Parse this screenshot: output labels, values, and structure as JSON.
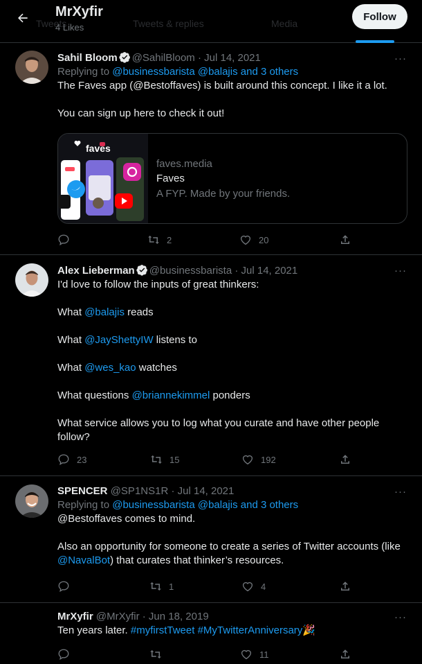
{
  "header": {
    "title": "MrXyfir",
    "subtitle": "4 Likes",
    "follow_label": "Follow",
    "ghost_tabs": [
      "Tweets",
      "Tweets & replies",
      "Media"
    ]
  },
  "tweets": [
    {
      "name": "Sahil Bloom",
      "verified": true,
      "handle": "@SahilBloom",
      "date": "Jul 14, 2021",
      "replying_prefix": "Replying to ",
      "replying_to": "@businessbarista @balajis and 3 others",
      "lines": [
        "The Faves app (@Bestoffaves) is built around this concept. I like it a lot.",
        "You can sign up here to check it out!"
      ],
      "card": {
        "brand": "faves",
        "domain": "faves.media",
        "title": "Faves",
        "description": "A FYP. Made by your friends."
      },
      "stats": {
        "replies": "",
        "retweets": "2",
        "likes": "20"
      }
    },
    {
      "name": "Alex Lieberman",
      "verified": true,
      "handle": "@businessbarista",
      "date": "Jul 14, 2021",
      "intro": "I'd love to follow the inputs of great thinkers:",
      "items": [
        {
          "pre": "What ",
          "mention": "@balajis",
          "post": " reads"
        },
        {
          "pre": "What ",
          "mention": "@JayShettyIW",
          "post": " listens to"
        },
        {
          "pre": "What ",
          "mention": "@wes_kao",
          "post": " watches"
        },
        {
          "pre": "What questions ",
          "mention": "@briannekimmel",
          "post": " ponders"
        }
      ],
      "closing_1": "What service allows you to log what you curate and have other people",
      "closing_2": "follow?",
      "stats": {
        "replies": "23",
        "retweets": "15",
        "likes": "192"
      }
    },
    {
      "name": "SPENCER",
      "verified": false,
      "handle": "@SP1NS1R",
      "date": "Jul 14, 2021",
      "replying_prefix": "Replying to ",
      "replying_to": "@businessbarista @balajis and 3 others",
      "line_1": "@Bestoffaves comes to mind.",
      "line_2": "Also an opportunity for someone to create a series of Twitter accounts (like",
      "line_3_mention": "@NavalBot",
      "line_3_rest": " that curates that thinker’s resources.",
      "line_3_open": "",
      "stats": {
        "replies": "",
        "retweets": "1",
        "likes": "4"
      }
    },
    {
      "name": "MrXyfir",
      "verified": false,
      "handle": "@MrXyfir",
      "date": "Jun 18, 2019",
      "text_pre": "Ten years later. ",
      "hashtag_1": "#myfirstTweet",
      "hashtag_2": "#MyTwitterAnniversary",
      "emoji": "🎉",
      "stats": {
        "replies": "",
        "retweets": "",
        "likes": "11"
      }
    }
  ],
  "separator": " · ",
  "more_label": "···",
  "colors": {
    "accent": "#1d9bf0",
    "background": "#000000",
    "muted": "#71767b",
    "divider": "#2f3336"
  }
}
